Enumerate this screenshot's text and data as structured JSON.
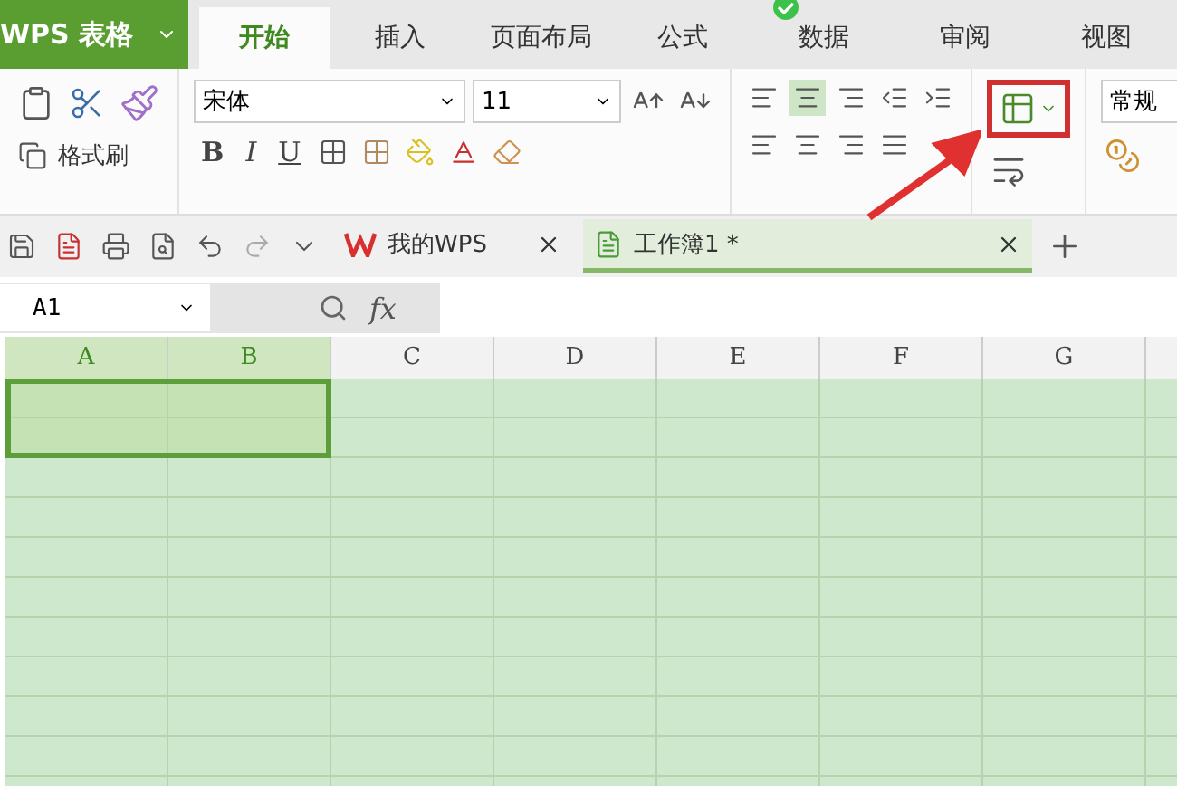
{
  "app_menu": {
    "label": "WPS 表格"
  },
  "tabs": [
    {
      "label": "开始",
      "selected": true
    },
    {
      "label": "插入",
      "selected": false
    },
    {
      "label": "页面布局",
      "selected": false
    },
    {
      "label": "公式",
      "selected": false
    },
    {
      "label": "数据",
      "selected": false
    },
    {
      "label": "审阅",
      "selected": false
    },
    {
      "label": "视图",
      "selected": false
    }
  ],
  "ribbon": {
    "format_painter_label": "格式刷",
    "font_name": "宋体",
    "font_size": "11",
    "style_buttons": [
      "B",
      "I",
      "U"
    ],
    "align_buttons": [
      {
        "selected": false
      },
      {
        "selected": true
      },
      {
        "selected": false
      }
    ],
    "merge_button": {
      "highlighted": true
    },
    "number_format": "常规"
  },
  "doc_tabs": [
    {
      "kind": "home",
      "label": "我的WPS",
      "selected": false
    },
    {
      "kind": "workbook",
      "label": "工作簿1 *",
      "selected": true
    }
  ],
  "formula_bar": {
    "name_box": "A1",
    "fx": "fx"
  },
  "columns": [
    {
      "label": "A",
      "selected": true
    },
    {
      "label": "B",
      "selected": true
    },
    {
      "label": "C",
      "selected": false
    },
    {
      "label": "D",
      "selected": false
    },
    {
      "label": "E",
      "selected": false
    },
    {
      "label": "F",
      "selected": false
    },
    {
      "label": "G",
      "selected": false
    }
  ],
  "rows": [
    {
      "selected": true
    },
    {
      "selected": true
    },
    {
      "selected": false
    },
    {
      "selected": false
    },
    {
      "selected": false
    },
    {
      "selected": false
    },
    {
      "selected": false
    },
    {
      "selected": false
    },
    {
      "selected": false
    },
    {
      "selected": false
    },
    {
      "selected": false
    }
  ]
}
